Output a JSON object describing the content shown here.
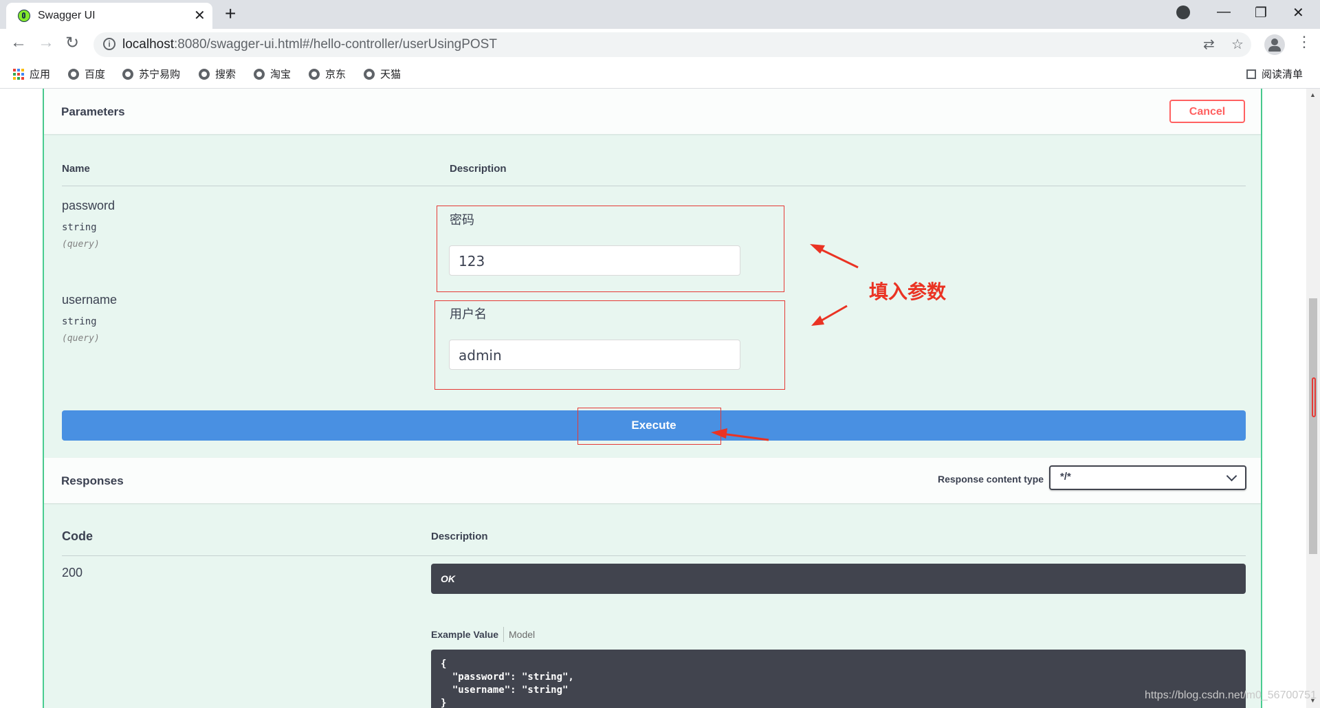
{
  "browser": {
    "tab_title": "Swagger UI",
    "tab_close": "✕",
    "new_tab": "+",
    "url_host": "localhost",
    "url_rest": ":8080/swagger-ui.html#/hello-controller/userUsingPOST",
    "bookmarks": [
      "应用",
      "百度",
      "苏宁易购",
      "搜索",
      "淘宝",
      "京东",
      "天猫"
    ],
    "reading_list": "阅读清单"
  },
  "parameters": {
    "title": "Parameters",
    "cancel_label": "Cancel",
    "col_name": "Name",
    "col_description": "Description",
    "items": [
      {
        "name": "password",
        "type": "string",
        "in": "(query)",
        "description": "密码",
        "value": "123"
      },
      {
        "name": "username",
        "type": "string",
        "in": "(query)",
        "description": "用户名",
        "value": "admin"
      }
    ],
    "execute_label": "Execute"
  },
  "annotation": {
    "text": "填入参数",
    "color": "#ea3323"
  },
  "responses": {
    "title": "Responses",
    "content_type_label": "Response content type",
    "content_type_value": "*/*",
    "col_code": "Code",
    "col_description": "Description",
    "code": "200",
    "status_text": "OK",
    "tab_example": "Example Value",
    "tab_model": "Model",
    "example_lines": [
      "{",
      "  \"password\": \"string\",",
      "  \"username\": \"string\"",
      "}"
    ]
  },
  "watermark": "https://blog.csdn.net/m0_56700751",
  "colors": {
    "accent_green": "#49cc90",
    "execute_blue": "#4990e2",
    "cancel_red": "#ff6060",
    "code_bg": "#41444e"
  }
}
